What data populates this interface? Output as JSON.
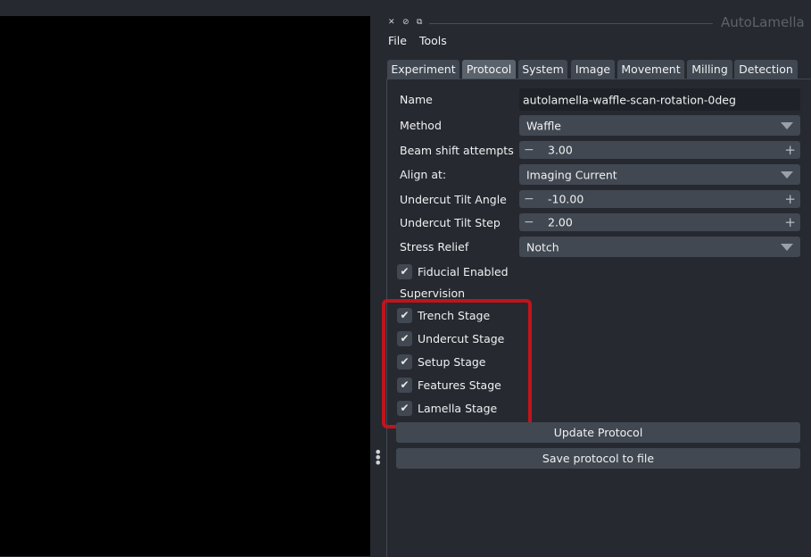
{
  "app_title": "AutoLamella",
  "window_icons": [
    "close-icon",
    "hide-icon",
    "float-icon"
  ],
  "menu": [
    "File",
    "Tools"
  ],
  "tabs": [
    "Experiment",
    "Protocol",
    "System",
    "Image",
    "Movement",
    "Milling",
    "Detection"
  ],
  "active_tab": "Protocol",
  "form": {
    "name": {
      "label": "Name",
      "value": "autolamella-waffle-scan-rotation-0deg"
    },
    "method": {
      "label": "Method",
      "value": "Waffle"
    },
    "beam_shift": {
      "label": "Beam shift attempts",
      "value": "3.00"
    },
    "align_at": {
      "label": "Align at:",
      "value": "Imaging Current"
    },
    "undercut_tilt_angle": {
      "label": "Undercut Tilt Angle",
      "value": "-10.00"
    },
    "undercut_tilt_step": {
      "label": "Undercut Tilt Step",
      "value": "2.00"
    },
    "stress_relief": {
      "label": "Stress Relief",
      "value": "Notch"
    },
    "fiducial": {
      "label": "Fiducial Enabled",
      "checked": true
    }
  },
  "supervision": {
    "label": "Supervision",
    "items": [
      {
        "label": "Trench Stage",
        "checked": true
      },
      {
        "label": "Undercut Stage",
        "checked": true
      },
      {
        "label": "Setup Stage",
        "checked": true
      },
      {
        "label": "Features Stage",
        "checked": true
      },
      {
        "label": "Lamella Stage",
        "checked": true
      }
    ]
  },
  "buttons": {
    "update": "Update Protocol",
    "save": "Save protocol to file"
  },
  "symbols": {
    "check": "✔",
    "minus": "−",
    "plus": "+",
    "close": "✕",
    "hide": "⊘",
    "float": "⧉",
    "handle": "⋮"
  },
  "colors": {
    "highlight": "#c0141c",
    "widget": "#414851",
    "active_tab": "#5a626c",
    "background": "#262930"
  }
}
